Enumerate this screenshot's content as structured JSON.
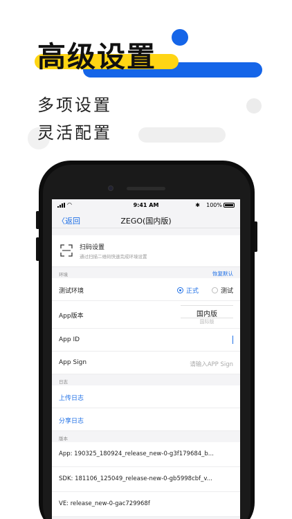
{
  "promo": {
    "headline": "高级设置",
    "sub1": "多项设置",
    "sub2": "灵活配置",
    "colors": {
      "blue": "#1565e8",
      "yellow": "#ffd514",
      "grey": "#ececec"
    }
  },
  "status_bar": {
    "time": "9:41 AM",
    "battery": "100%",
    "bluetooth_icon": "bluetooth-icon",
    "wifi_icon": "wifi-icon"
  },
  "nav": {
    "back_label": "返回",
    "title": "ZEGO(国内版)"
  },
  "scan": {
    "title": "扫码设置",
    "description": "通过扫描二维码快速完成环境设置",
    "icon": "scan-icon"
  },
  "env_section": {
    "label": "环境",
    "restore_label": "恢复默认",
    "test_env_label": "测试环境",
    "options": [
      "正式",
      "测试"
    ],
    "selected": "正式",
    "app_version_label": "App版本",
    "app_version_value": "国内版",
    "app_version_next": "国际版",
    "app_id_label": "App ID",
    "app_sign_label": "App Sign",
    "app_sign_placeholder": "请输入APP Sign"
  },
  "log_section": {
    "label": "日志",
    "upload_label": "上传日志",
    "share_label": "分享日志"
  },
  "version_section": {
    "label": "版本",
    "app": "App: 190325_180924_release_new-0-g3f179684_b...",
    "sdk": "SDK: 181106_125049_release-new-0-gb5998cbf_v...",
    "ve": "VE: release_new-0-gac729968f"
  },
  "accent_color": "#1e6fe6"
}
